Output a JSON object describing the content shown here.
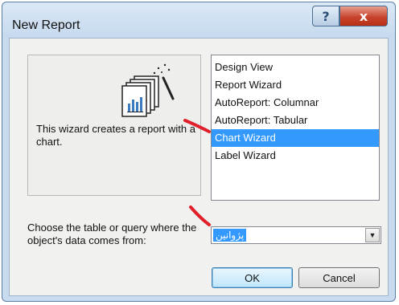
{
  "window": {
    "title": "New Report",
    "help_glyph": "?",
    "close_glyph": "x"
  },
  "preview": {
    "description": "This wizard creates a report with a chart.",
    "icon": "chart-report-wizard-icon"
  },
  "report_types": {
    "items": [
      {
        "label": "Design View",
        "selected": false
      },
      {
        "label": "Report Wizard",
        "selected": false
      },
      {
        "label": "AutoReport:  Columnar",
        "selected": false
      },
      {
        "label": "AutoReport:  Tabular",
        "selected": false
      },
      {
        "label": "Chart Wizard",
        "selected": true
      },
      {
        "label": "Label Wizard",
        "selected": false
      }
    ]
  },
  "source": {
    "label": "Choose the table or query where the object's data comes from:",
    "value": "پژوانین",
    "dropdown_glyph": "▼"
  },
  "buttons": {
    "ok": "OK",
    "cancel": "Cancel"
  },
  "colors": {
    "selection": "#3399ff",
    "annotation_mark": "#e0202a"
  }
}
